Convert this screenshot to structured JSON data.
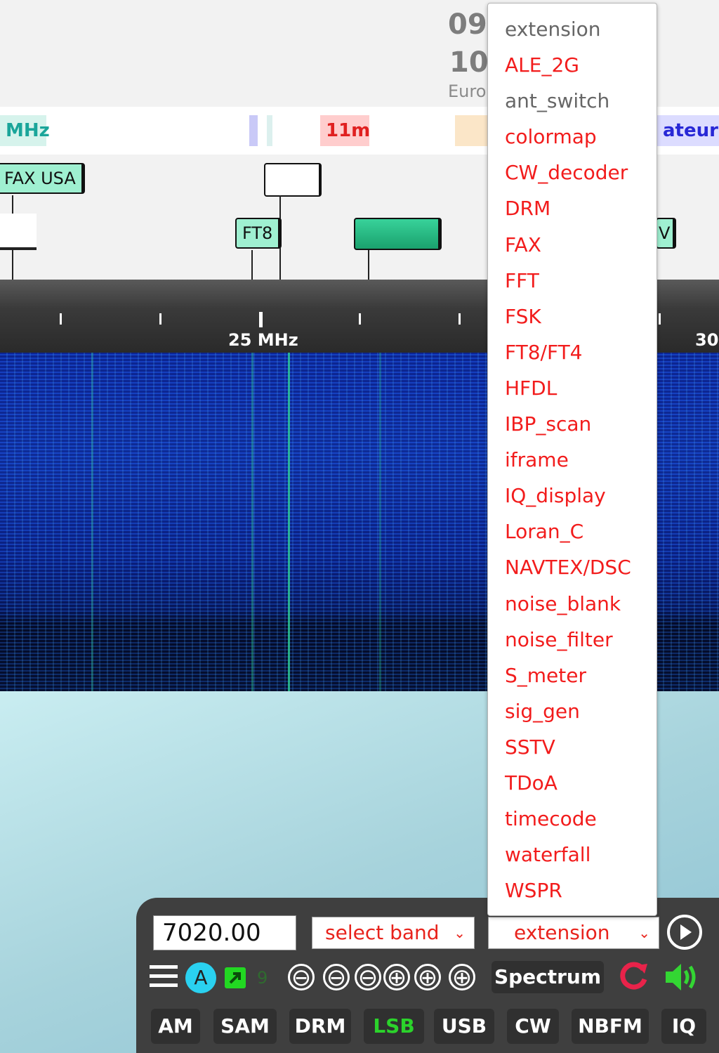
{
  "header": {
    "clock_line1": "09",
    "clock_line2": "10",
    "region_label": "Euro"
  },
  "band_strip": [
    {
      "label": "MHz",
      "color": "#1aa59a",
      "bg": "#d6f3ec"
    },
    {
      "label": "11m",
      "color": "#e02020",
      "bg": "#ffcdcd"
    },
    {
      "label": "ateur",
      "color": "#2727d6",
      "bg": "#dcdcff"
    }
  ],
  "stations": {
    "fax_usa": "FAX USA",
    "ft8": "FT8",
    "partial_v": "V"
  },
  "scale": {
    "label_25": "25 MHz",
    "label_30": "30"
  },
  "dropdown": {
    "header": "extension",
    "items": [
      "ALE_2G",
      "ant_switch",
      "colormap",
      "CW_decoder",
      "DRM",
      "FAX",
      "FFT",
      "FSK",
      "FT8/FT4",
      "HFDL",
      "IBP_scan",
      "iframe",
      "IQ_display",
      "Loran_C",
      "NAVTEX/DSC",
      "noise_blank",
      "noise_filter",
      "S_meter",
      "sig_gen",
      "SSTV",
      "TDoA",
      "timecode",
      "waterfall",
      "WSPR"
    ]
  },
  "controls": {
    "frequency": "7020.00",
    "band_select": "select band",
    "extension_select": "extension",
    "play_icon": "play-circle-icon",
    "menu_icon": "hamburger-icon",
    "a_badge": "A",
    "small_number": "9",
    "zoom_buttons": [
      "⊖",
      "⊖",
      "⊖",
      "⊕",
      "⊕",
      "⊕"
    ],
    "spectrum_button": "Spectrum",
    "modes": [
      "AM",
      "SAM",
      "DRM",
      "LSB",
      "USB",
      "CW",
      "NBFM",
      "IQ"
    ],
    "active_mode": "LSB",
    "accent": "#2bd32b"
  }
}
